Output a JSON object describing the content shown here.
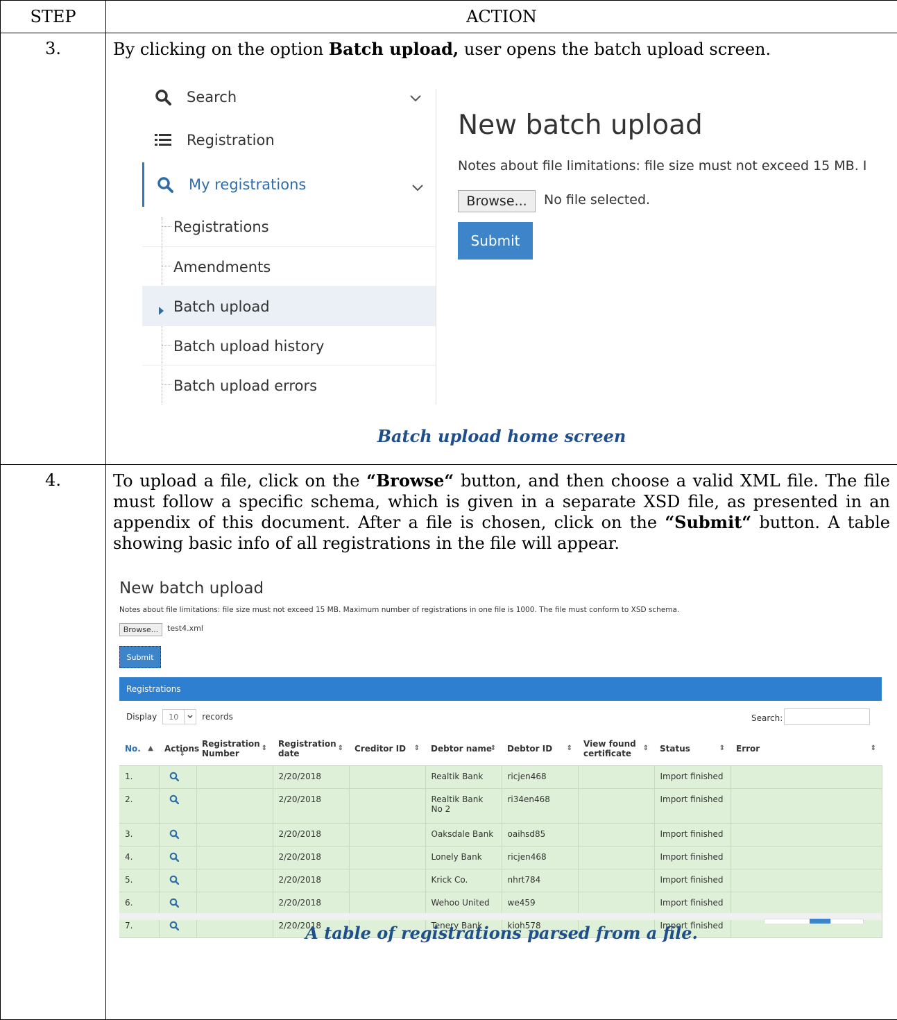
{
  "table": {
    "header_step": "STEP",
    "header_action": "ACTION"
  },
  "step3": {
    "number": "3.",
    "text_before": "By clicking on the option ",
    "text_bold": "Batch upload,",
    "text_after": " user opens the batch upload screen.",
    "caption": "Batch upload home screen",
    "sidebar": {
      "search": "Search",
      "registration": "Registration",
      "my_registrations": "My registrations",
      "sub_items": [
        "Registrations",
        "Amendments",
        "Batch upload",
        "Batch upload history",
        "Batch upload errors"
      ]
    },
    "content": {
      "title": "New batch upload",
      "notes": "Notes about file limitations: file size must not exceed 15 MB. I",
      "browse_label": "Browse...",
      "file_status": "No file selected.",
      "submit_label": "Submit"
    }
  },
  "step4": {
    "number": "4.",
    "t1": "To upload a file, click on the ",
    "b1": "“Browse“",
    "t2": " button, and then choose a valid XML file. The file must follow a specific schema, which is given in a separate XSD file, as presented in an appendix of this document. After a file is chosen, click on the ",
    "b2": "“Submit“",
    "t3": " button. A table showing basic info of all registrations in the file will appear.",
    "caption": "A table of registrations parsed from a file.",
    "screen": {
      "title": "New batch upload",
      "notes": "Notes about file limitations: file size must not exceed 15 MB. Maximum number of registrations in one file is 1000. The file must conform to XSD schema.",
      "browse_label": "Browse...",
      "file_name": "test4.xml",
      "submit_label": "Submit",
      "panel_title": "Registrations",
      "display_label": "Display",
      "display_value": "10",
      "records_label": "records",
      "search_label": "Search:",
      "columns": [
        "No.",
        "Actions",
        "Registration Number",
        "Registration date",
        "Creditor ID",
        "Debtor name",
        "Debtor ID",
        "View found certificate",
        "Status",
        "Error"
      ],
      "rows": [
        {
          "no": "1.",
          "reg_number": "",
          "reg_date": "2/20/2018",
          "creditor_id": "",
          "debtor_name": "Realtik Bank",
          "debtor_id": "ricjen468",
          "certificate": "",
          "status": "Import finished",
          "error": ""
        },
        {
          "no": "2.",
          "reg_number": "",
          "reg_date": "2/20/2018",
          "creditor_id": "",
          "debtor_name": "Realtik Bank No 2",
          "debtor_id": "ri34en468",
          "certificate": "",
          "status": "Import finished",
          "error": ""
        },
        {
          "no": "3.",
          "reg_number": "",
          "reg_date": "2/20/2018",
          "creditor_id": "",
          "debtor_name": "Oaksdale Bank",
          "debtor_id": "oaihsd85",
          "certificate": "",
          "status": "Import finished",
          "error": ""
        },
        {
          "no": "4.",
          "reg_number": "",
          "reg_date": "2/20/2018",
          "creditor_id": "",
          "debtor_name": "Lonely Bank",
          "debtor_id": "ricjen468",
          "certificate": "",
          "status": "Import finished",
          "error": ""
        },
        {
          "no": "5.",
          "reg_number": "",
          "reg_date": "2/20/2018",
          "creditor_id": "",
          "debtor_name": "Krick Co.",
          "debtor_id": "nhrt784",
          "certificate": "",
          "status": "Import finished",
          "error": ""
        },
        {
          "no": "6.",
          "reg_number": "",
          "reg_date": "2/20/2018",
          "creditor_id": "",
          "debtor_name": "Wehoo United",
          "debtor_id": "we459",
          "certificate": "",
          "status": "Import finished",
          "error": ""
        },
        {
          "no": "7.",
          "reg_number": "",
          "reg_date": "2/20/2018",
          "creditor_id": "",
          "debtor_name": "Tenery Bank",
          "debtor_id": "kioh578",
          "certificate": "",
          "status": "Import finished",
          "error": ""
        }
      ]
    }
  },
  "colors": {
    "caption": "#1f4e8c",
    "primary_button": "#3d85c8",
    "panel_header": "#2f7fd1",
    "row_success": "#dff0d8",
    "icon_blue": "#2e6da8"
  }
}
